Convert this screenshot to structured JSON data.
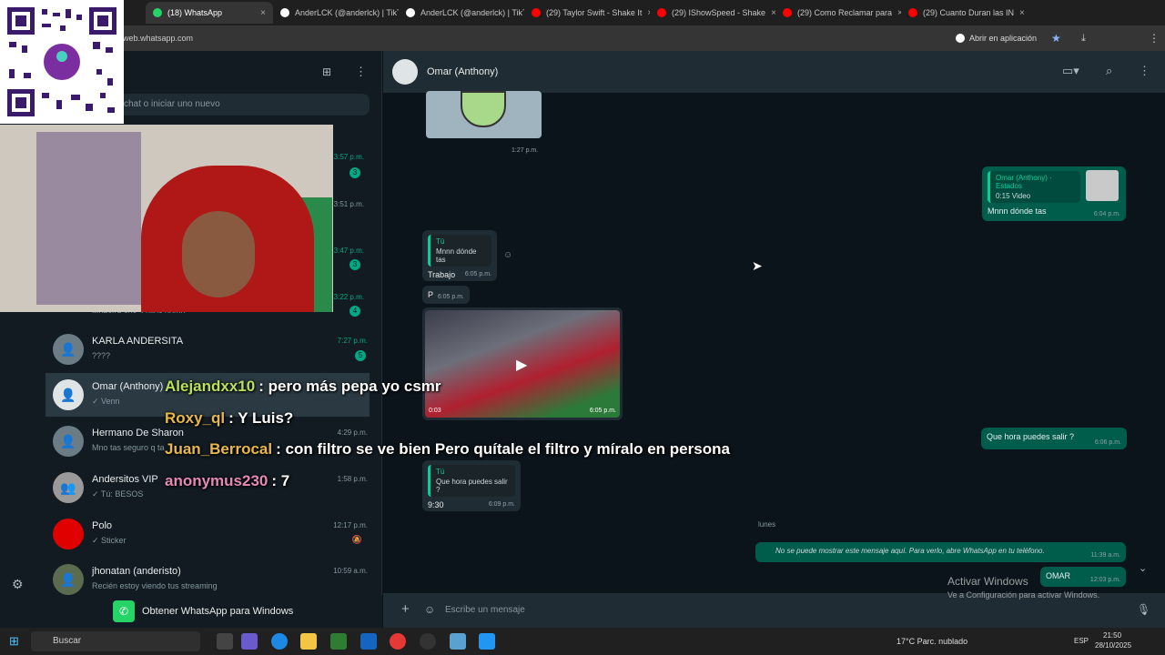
{
  "browser": {
    "tabs": [
      {
        "label": "(18) WhatsApp",
        "color": "#25d366"
      },
      {
        "label": "AnderLCK (@anderlck) | TikTok",
        "color": "#ffffff"
      },
      {
        "label": "AnderLCK (@anderlck) | TikTok",
        "color": "#ffffff"
      },
      {
        "label": "(29) Taylor Swift - Shake It",
        "color": "#ff0000"
      },
      {
        "label": "(29) IShowSpeed - Shake",
        "color": "#ff0000"
      },
      {
        "label": "(29) Como Reclamar para",
        "color": "#ff0000"
      },
      {
        "label": "(29) Cuanto Duran las IN",
        "color": "#ff0000"
      }
    ],
    "url": "web.whatsapp.com",
    "open_app": "Abrir en aplicación"
  },
  "sidebar": {
    "search_placeholder": "chat o iniciar uno nuevo",
    "partial_times": [
      {
        "time": "3:57 p.m.",
        "badge": "3"
      },
      {
        "time": "3:51 p.m.",
        "badge": ""
      },
      {
        "time": "3:47 p.m.",
        "badge": "3"
      },
      {
        "time": "3:22 p.m.",
        "badge": "4"
      }
    ],
    "partial_msg": "Muestra sus 3 hijos domo",
    "chats": [
      {
        "name": "KARLA ANDERSITA",
        "msg": "????",
        "time": "7:27 p.m.",
        "badge": "5",
        "green": true
      },
      {
        "name": "Omar (Anthony)",
        "msg": "✓ Venn",
        "time": "",
        "badge": "",
        "green": false
      },
      {
        "name": "Hermano De Sharon",
        "msg": "Mno tas seguro q ta",
        "time": "4:29 p.m.",
        "badge": "",
        "green": false
      },
      {
        "name": "Andersitos VIP",
        "msg": "✓ Tú: BESOS",
        "time": "1:58 p.m.",
        "badge": "",
        "green": false
      },
      {
        "name": "Polo",
        "msg": "✓ Sticker",
        "time": "12:17 p.m.",
        "badge": "",
        "green": false
      },
      {
        "name": "jhonatan (anderisto)",
        "msg": "Recién estoy viendo tus streaming",
        "time": "10:59 a.m.",
        "badge": "",
        "green": false
      }
    ],
    "get_app": "Obtener WhatsApp para Windows"
  },
  "conversation": {
    "contact": "Omar (Anthony)",
    "messages": {
      "m1_time": "1:27 p.m.",
      "status_reply_title": "Omar (Anthony) · Estados",
      "status_reply_sub": "0:15 Video",
      "status_reply_text": "Mnnn dónde tas",
      "status_reply_time": "6:04 p.m.",
      "q1_who": "Tú",
      "q1_text": "Mnnn dónde tas",
      "q1_reply": "Trabajo",
      "q1_time": "6:05 p.m.",
      "p_text": "P",
      "p_time": "6:05 p.m.",
      "video_dur": "0:03",
      "video_time": "6:05 p.m.",
      "out2_text": "Que hora puedes salir ?",
      "out2_time": "6:06 p.m.",
      "q2_who": "Tú",
      "q2_text": "Que hora puedes salir ?",
      "q2_reply": "9:30",
      "q2_time": "6:09 p.m.",
      "day": "lunes",
      "hidden_text": "No se puede mostrar este mensaje aquí. Para verlo, abre WhatsApp en tu teléfono.",
      "hidden_time": "11:39 a.m.",
      "last_text": "OMAR",
      "last_time": "12:03 p.m."
    },
    "composer_placeholder": "Escribe un mensaje"
  },
  "stream_chat": [
    {
      "user": "Alejandxx10",
      "color": "#b8e05a",
      "text": ": pero más pepa yo csmr"
    },
    {
      "user": "Roxy_ql",
      "color": "#e8b84a",
      "text": ": Y Luis?"
    },
    {
      "user": "Juan_Berrocal",
      "color": "#e8b84a",
      "text": ": con filtro se ve bien Pero quítale el filtro y míralo en persona"
    },
    {
      "user": "anonymus230",
      "color": "#e58ab5",
      "text": ": 7"
    }
  ],
  "windows": {
    "activate_title": "Activar Windows",
    "activate_sub": "Ve a Configuración para activar Windows.",
    "search": "Buscar",
    "weather": "17°C  Parc. nublado",
    "lang": "ESP",
    "time": "21:50",
    "date": "28/10/2025"
  }
}
